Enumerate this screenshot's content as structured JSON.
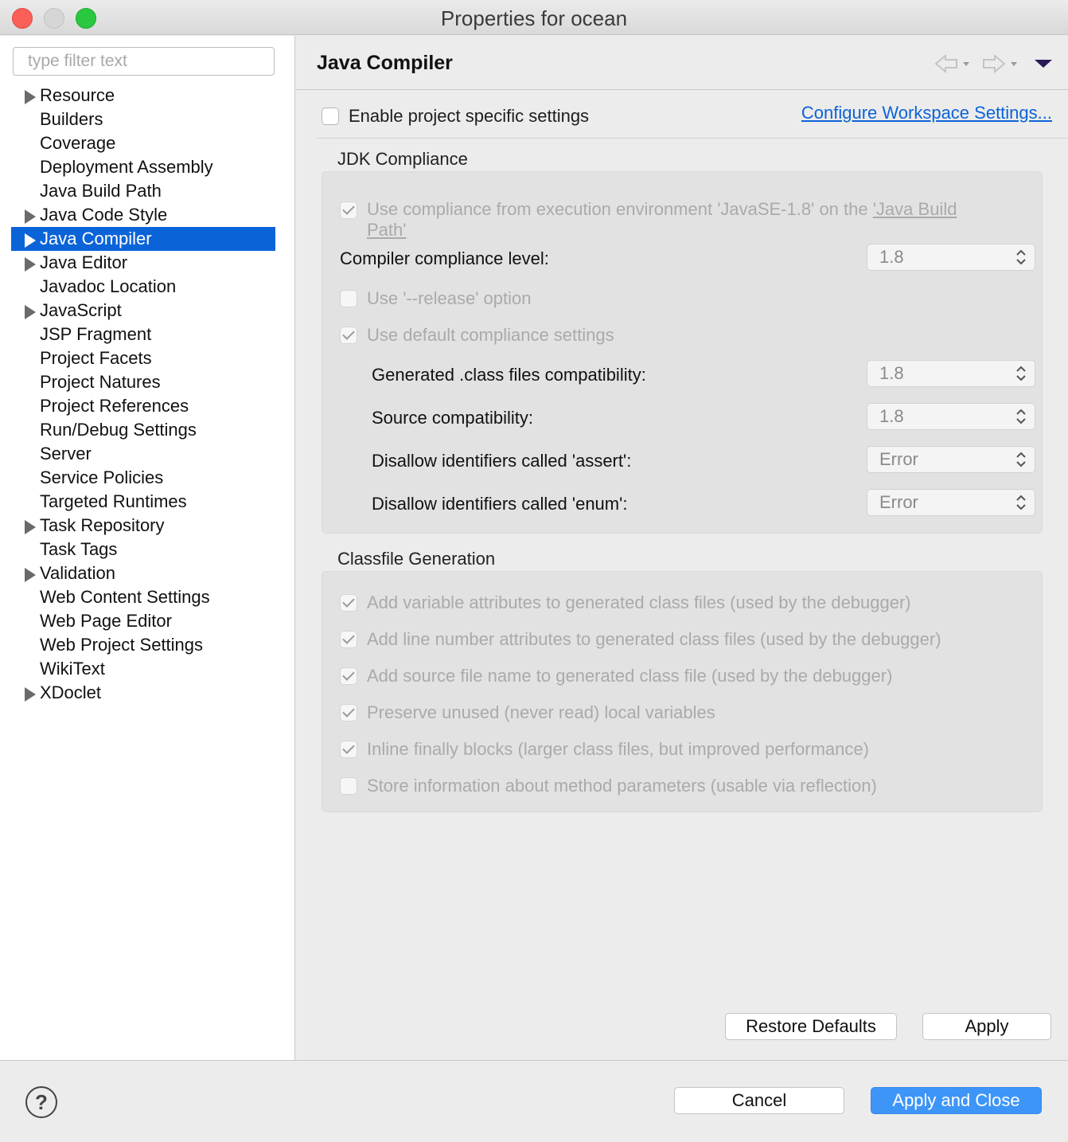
{
  "window": {
    "title": "Properties for ocean"
  },
  "filter": {
    "placeholder": "type filter text"
  },
  "tree": [
    {
      "label": "Resource",
      "expandable": true,
      "selected": false
    },
    {
      "label": "Builders",
      "expandable": false,
      "selected": false
    },
    {
      "label": "Coverage",
      "expandable": false,
      "selected": false
    },
    {
      "label": "Deployment Assembly",
      "expandable": false,
      "selected": false
    },
    {
      "label": "Java Build Path",
      "expandable": false,
      "selected": false
    },
    {
      "label": "Java Code Style",
      "expandable": true,
      "selected": false
    },
    {
      "label": "Java Compiler",
      "expandable": true,
      "selected": true
    },
    {
      "label": "Java Editor",
      "expandable": true,
      "selected": false
    },
    {
      "label": "Javadoc Location",
      "expandable": false,
      "selected": false
    },
    {
      "label": "JavaScript",
      "expandable": true,
      "selected": false
    },
    {
      "label": "JSP Fragment",
      "expandable": false,
      "selected": false
    },
    {
      "label": "Project Facets",
      "expandable": false,
      "selected": false
    },
    {
      "label": "Project Natures",
      "expandable": false,
      "selected": false
    },
    {
      "label": "Project References",
      "expandable": false,
      "selected": false
    },
    {
      "label": "Run/Debug Settings",
      "expandable": false,
      "selected": false
    },
    {
      "label": "Server",
      "expandable": false,
      "selected": false
    },
    {
      "label": "Service Policies",
      "expandable": false,
      "selected": false
    },
    {
      "label": "Targeted Runtimes",
      "expandable": false,
      "selected": false
    },
    {
      "label": "Task Repository",
      "expandable": true,
      "selected": false
    },
    {
      "label": "Task Tags",
      "expandable": false,
      "selected": false
    },
    {
      "label": "Validation",
      "expandable": true,
      "selected": false
    },
    {
      "label": "Web Content Settings",
      "expandable": false,
      "selected": false
    },
    {
      "label": "Web Page Editor",
      "expandable": false,
      "selected": false
    },
    {
      "label": "Web Project Settings",
      "expandable": false,
      "selected": false
    },
    {
      "label": "WikiText",
      "expandable": false,
      "selected": false
    },
    {
      "label": "XDoclet",
      "expandable": true,
      "selected": false
    }
  ],
  "page": {
    "title": "Java Compiler",
    "enable_specific": {
      "label": "Enable project specific settings",
      "checked": false
    },
    "configure_link": "Configure Workspace Settings..."
  },
  "jdk": {
    "title": "JDK Compliance",
    "use_compliance_prefix": "Use compliance from execution environment 'JavaSE-1.8' on the ",
    "use_compliance_link": "'Java Build",
    "use_compliance_link2": "Path'",
    "compliance_label": "Compiler compliance level:",
    "compliance_value": "1.8",
    "release_label": "Use '--release' option",
    "default_label": "Use default compliance settings",
    "generated_label": "Generated .class files compatibility:",
    "generated_value": "1.8",
    "source_label": "Source compatibility:",
    "source_value": "1.8",
    "assert_label": "Disallow identifiers called 'assert':",
    "assert_value": "Error",
    "enum_label": "Disallow identifiers called 'enum':",
    "enum_value": "Error"
  },
  "classfile": {
    "title": "Classfile Generation",
    "options": [
      {
        "label": "Add variable attributes to generated class files (used by the debugger)",
        "checked": true
      },
      {
        "label": "Add line number attributes to generated class files (used by the debugger)",
        "checked": true
      },
      {
        "label": "Add source file name to generated class file (used by the debugger)",
        "checked": true
      },
      {
        "label": "Preserve unused (never read) local variables",
        "checked": true
      },
      {
        "label": "Inline finally blocks (larger class files, but improved performance)",
        "checked": true
      },
      {
        "label": "Store information about method parameters (usable via reflection)",
        "checked": false
      }
    ]
  },
  "buttons": {
    "restore": "Restore Defaults",
    "apply": "Apply",
    "cancel": "Cancel",
    "apply_close": "Apply and Close",
    "help": "?"
  }
}
